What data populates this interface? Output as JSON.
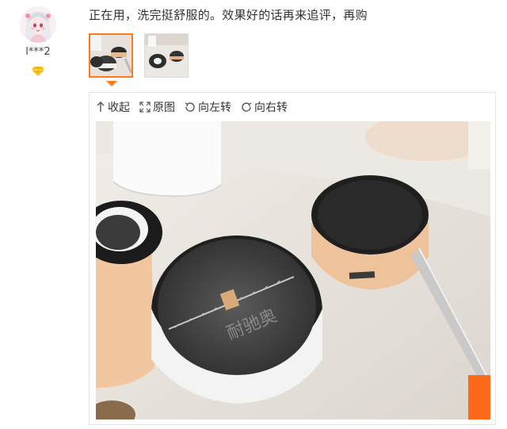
{
  "user": {
    "name": "l***2",
    "avatar_icon": "anime-girl-avatar",
    "badge_icon": "vip-diamond-icon",
    "badge_color": "#f5b400"
  },
  "review": {
    "text": "正在用，洗完挺舒服的。效果好的话再来追评，再购"
  },
  "thumbnails": {
    "count": 2,
    "selected_index": 0,
    "selected_border_color": "#ff7a1a"
  },
  "viewer": {
    "toolbar": {
      "collapse_label": "收起",
      "original_label": "原图",
      "rotate_left_label": "向左转",
      "rotate_right_label": "向右转"
    },
    "photo_watermark": "耐驰奥"
  }
}
